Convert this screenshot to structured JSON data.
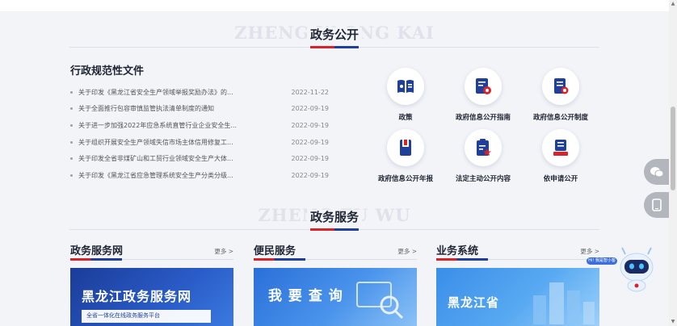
{
  "sections": {
    "gov_affairs": {
      "bg_text": "ZHENG W  ONG KAI",
      "title": "政务公开"
    },
    "gov_service": {
      "bg_text": "ZHENG  FU WU",
      "title": "政务服务"
    }
  },
  "documents": {
    "title": "行政规范性文件",
    "items": [
      {
        "title": "关于印发《黑龙江省安全生产领域举报奖励办法》的...",
        "date": "2022-11-22"
      },
      {
        "title": "关于全面推行包容审慎监管执法清单制度的通知",
        "date": "2022-09-19"
      },
      {
        "title": "关于进一步加强2022年应急系统直管行业企业安全生...",
        "date": "2022-09-19"
      },
      {
        "title": "关于组织开展安全生产领域失信市场主体信用修复工...",
        "date": "2022-09-19"
      },
      {
        "title": "关于印发全省非煤矿山和工贸行业领域安全生产大体...",
        "date": "2022-09-19"
      },
      {
        "title": "关于印发《黑龙江省应急管理系统安全生产分类分级...",
        "date": "2022-09-19"
      }
    ]
  },
  "icon_grid": [
    {
      "label": "政策",
      "icon": "policy-book-icon"
    },
    {
      "label": "政府信息公开指南",
      "icon": "disclosure-guide-icon"
    },
    {
      "label": "政府信息公开制度",
      "icon": "disclosure-system-icon"
    },
    {
      "label": "政府信息公开年报",
      "icon": "annual-report-icon"
    },
    {
      "label": "法定主动公开内容",
      "icon": "statutory-content-icon"
    },
    {
      "label": "依申请公开",
      "icon": "apply-disclosure-icon"
    }
  ],
  "services": [
    {
      "title": "政务服务网",
      "more": "更多 >",
      "banner_text": "黑龙江政务服务网",
      "banner_sub": "全省一体化在线政务服务平台"
    },
    {
      "title": "便民服务",
      "more": "更多 >",
      "banner_text": "我 要 查 询"
    },
    {
      "title": "业务系统",
      "more": "更多 >",
      "banner_text": "黑龙江省"
    }
  ],
  "floating": {
    "robot_badge": "Hi! 我是智小客"
  },
  "colors": {
    "accent_red": "#d7232a",
    "accent_blue": "#1f3f9b",
    "icon_blue": "#1f3f9b",
    "icon_red": "#d7232a"
  }
}
